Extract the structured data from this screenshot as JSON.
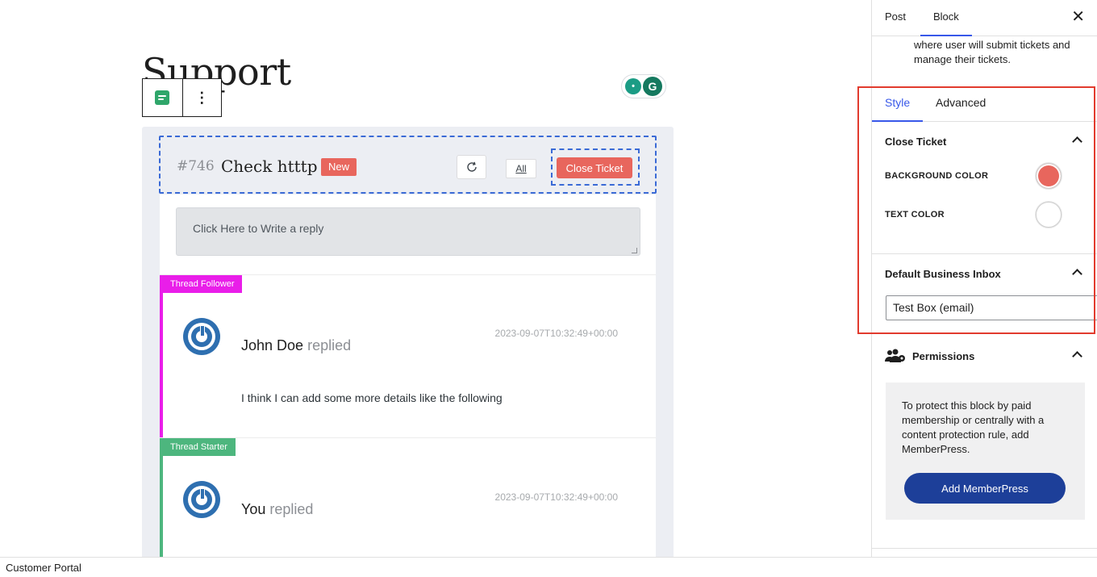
{
  "page": {
    "title": "Support"
  },
  "ticket": {
    "id": "#746",
    "title": "Check htttp",
    "status_badge": "New",
    "all_label": "All",
    "close_label": "Close Ticket",
    "reply_placeholder": "Click Here to Write a reply"
  },
  "threads": [
    {
      "tag": "Thread Follower",
      "tag_color": "#e91ee9",
      "author": "John Doe",
      "action": "replied",
      "timestamp": "2023-09-07T10:32:49+00:00",
      "message": "I think I can add some more details like the following"
    },
    {
      "tag": "Thread Starter",
      "tag_color": "#4db67e",
      "author": "You",
      "action": "replied",
      "timestamp": "2023-09-07T10:32:49+00:00",
      "message": ""
    }
  ],
  "sidebar": {
    "tabs": [
      "Post",
      "Block"
    ],
    "active_tab": "Block",
    "description": "where user will submit tickets and manage their tickets.",
    "style_tabs": [
      "Style",
      "Advanced"
    ],
    "active_style_tab": "Style",
    "close_ticket_panel": {
      "title": "Close Ticket",
      "background_label": "BACKGROUND COLOR",
      "background_color": "#e8665d",
      "text_label": "TEXT COLOR",
      "text_color": "#ffffff"
    },
    "inbox_panel": {
      "title": "Default Business Inbox",
      "selected": "Test Box (email)"
    },
    "permissions_panel": {
      "title": "Permissions",
      "text": "To protect this block by paid membership or centrally with a content protection rule, add MemberPress.",
      "button": "Add MemberPress"
    }
  },
  "footer": {
    "breadcrumb": "Customer Portal"
  },
  "colors": {
    "accent": "#3858e9",
    "close_button": "#e8665d",
    "memberpress_button": "#1d3f99",
    "highlight_box": "#e23b2e"
  }
}
